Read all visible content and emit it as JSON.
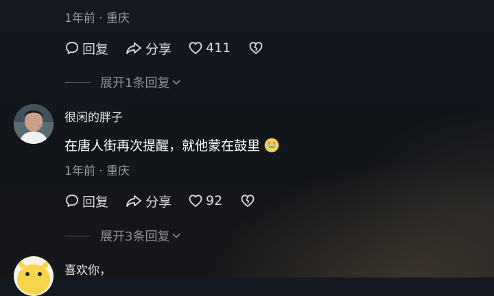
{
  "comment1": {
    "meta": "1年前 · 重庆",
    "reply_label": "回复",
    "share_label": "分享",
    "like_count": "411",
    "expand_label": "展开1条回复"
  },
  "comment2": {
    "username": "很闲的胖子",
    "text": "在唐人街再次提醒，就他蒙在鼓里",
    "meta": "1年前 · 重庆",
    "reply_label": "回复",
    "share_label": "分享",
    "like_count": "92",
    "expand_label": "展开3条回复"
  },
  "comment3": {
    "username": "喜欢你，"
  },
  "colors": {
    "text_primary": "#ffffff",
    "text_secondary": "#9a9ca3",
    "action": "#d9dade"
  },
  "icons": [
    "comment-bubble-icon",
    "share-arrow-icon",
    "heart-icon",
    "broken-heart-icon",
    "chevron-down-icon",
    "crying-face-emoji-icon"
  ]
}
